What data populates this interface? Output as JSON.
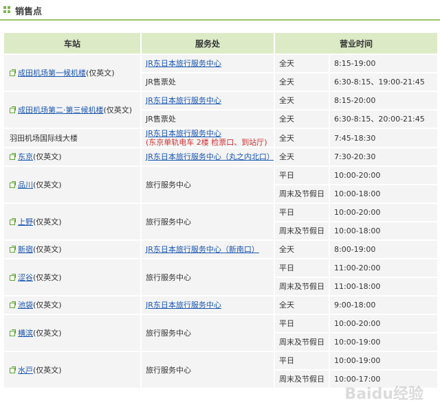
{
  "section_title": "销售点",
  "headers": {
    "station": "车站",
    "office": "服务处",
    "hours": "营业时间"
  },
  "stations": [
    {
      "name": "成田机场第一候机楼",
      "note": "(仅英文)",
      "link": true,
      "offices": [
        {
          "name": "JR东日本旅行服务中心",
          "link": true,
          "hours": [
            {
              "day": "全天",
              "time": "8:15-19:00"
            }
          ]
        },
        {
          "name": "JR售票处",
          "link": false,
          "hours": [
            {
              "day": "全天",
              "time": "6:30-8:15、19:00-21:45"
            }
          ]
        }
      ]
    },
    {
      "name": "成田机场第二·第三候机楼",
      "note": "(仅英文)",
      "link": true,
      "offices": [
        {
          "name": "JR东日本旅行服务中心",
          "link": true,
          "hours": [
            {
              "day": "全天",
              "time": "8:15-20:00"
            }
          ]
        },
        {
          "name": "JR售票处",
          "link": false,
          "hours": [
            {
              "day": "全天",
              "time": "6:30-8:15、20:00-21:45"
            }
          ]
        }
      ]
    },
    {
      "name": "羽田机场国际线大楼",
      "note": "",
      "link": false,
      "offices": [
        {
          "name": "JR东日本旅行服务中心",
          "link": true,
          "sub": "(东京单轨电车 2楼 检票口、到站厅)",
          "hours": [
            {
              "day": "全天",
              "time": "7:45-18:30"
            }
          ]
        }
      ]
    },
    {
      "name": "东京",
      "note": "(仅英文)",
      "link": true,
      "offices": [
        {
          "name": "JR东日本旅行服务中心（丸之内北口）",
          "link": true,
          "hours": [
            {
              "day": "全天",
              "time": "7:30-20:30"
            }
          ]
        }
      ]
    },
    {
      "name": "品川",
      "note": "(仅英文)",
      "link": true,
      "offices": [
        {
          "name": "旅行服务中心",
          "link": false,
          "hours": [
            {
              "day": "平日",
              "time": "10:00-20:00"
            },
            {
              "day": "周末及节假日",
              "time": "10:00-18:00"
            }
          ]
        }
      ]
    },
    {
      "name": "上野",
      "note": "(仅英文)",
      "link": true,
      "offices": [
        {
          "name": "旅行服务中心",
          "link": false,
          "hours": [
            {
              "day": "平日",
              "time": "10:00-20:00"
            },
            {
              "day": "周末及节假日",
              "time": "10:00-18:00"
            }
          ]
        }
      ]
    },
    {
      "name": "新宿",
      "note": "(仅英文)",
      "link": true,
      "offices": [
        {
          "name": "JR东日本旅行服务中心（新南口）",
          "link": true,
          "hours": [
            {
              "day": "全天",
              "time": "8:00-19:00"
            }
          ]
        }
      ]
    },
    {
      "name": "涩谷",
      "note": "(仅英文)",
      "link": true,
      "offices": [
        {
          "name": "旅行服务中心",
          "link": false,
          "hours": [
            {
              "day": "平日",
              "time": "11:00-20:00"
            },
            {
              "day": "周末及节假日",
              "time": "11:00-18:00"
            }
          ]
        }
      ]
    },
    {
      "name": "池袋",
      "note": "(仅英文)",
      "link": true,
      "offices": [
        {
          "name": "JR东日本旅行服务中心",
          "link": true,
          "hours": [
            {
              "day": "全天",
              "time": "9:00-18:00"
            }
          ]
        }
      ]
    },
    {
      "name": "横滨",
      "note": "(仅英文)",
      "link": true,
      "offices": [
        {
          "name": "旅行服务中心",
          "link": false,
          "hours": [
            {
              "day": "平日",
              "time": "10:00-20:00"
            },
            {
              "day": "周末及节假日",
              "time": "10:00-19:00"
            }
          ]
        }
      ]
    },
    {
      "name": "水戸",
      "note": "(仅英文)",
      "link": true,
      "offices": [
        {
          "name": "旅行服务中心",
          "link": false,
          "hours": [
            {
              "day": "平日",
              "time": "10:00-19:00"
            },
            {
              "day": "周末及节假日",
              "time": "10:00-17:00"
            }
          ]
        }
      ]
    }
  ],
  "watermark": "Baidu经验",
  "colors": {
    "header_bg": "#dcebc6",
    "row_bg": "#f4f4f4",
    "link": "#1a56b0",
    "note_red": "#d03030",
    "accent_green": "#7ab648"
  }
}
